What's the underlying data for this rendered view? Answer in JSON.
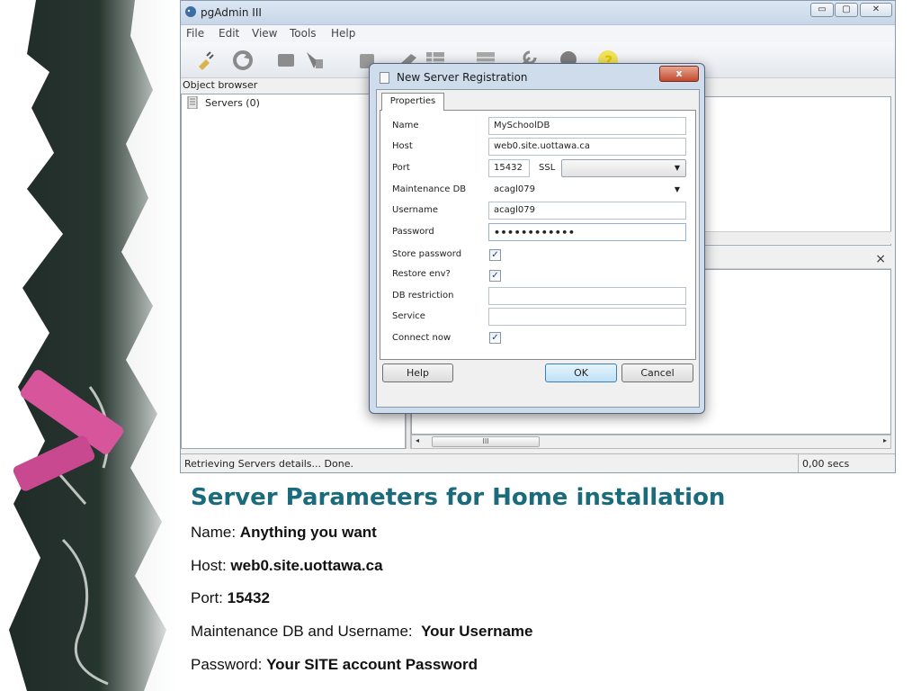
{
  "app": {
    "title": "pgAdmin III",
    "caption_buttons": {
      "minimize": "▭",
      "maximize": "▢",
      "close": "✕"
    },
    "menu": [
      "File",
      "Edit",
      "View",
      "Tools",
      "Help"
    ],
    "toolbar_icons": [
      "plug-icon",
      "refresh-icon",
      "properties-icon",
      "create-object-icon",
      "delete-icon",
      "sql-icon",
      "view-data-icon",
      "filter-icon",
      "maintenance-icon",
      "plugin-icon",
      "help-icon"
    ]
  },
  "object_browser": {
    "header": "Object browser",
    "tree": [
      {
        "label": "Servers (0)",
        "icon": "servers-icon"
      }
    ]
  },
  "sql_pane": {
    "close_glyph": "×"
  },
  "scrollbar": {
    "left_arrow": "◂",
    "right_arrow": "▸",
    "thumb_grip": "III"
  },
  "statusbar": {
    "message": "Retrieving Servers details... Done.",
    "timer": "0,00 secs"
  },
  "dialog": {
    "title": "New Server Registration",
    "close_glyph": "x",
    "tab": "Properties",
    "fields": {
      "name": {
        "label": "Name",
        "value": "MySchoolDB"
      },
      "host": {
        "label": "Host",
        "value": "web0.site.uottawa.ca"
      },
      "port": {
        "label": "Port",
        "value": "15432"
      },
      "ssl": {
        "label": "SSL",
        "value": ""
      },
      "maintenance_db": {
        "label": "Maintenance DB",
        "value": "acagl079"
      },
      "username": {
        "label": "Username",
        "value": "acagl079"
      },
      "password": {
        "label": "Password",
        "value": "••••••••••••"
      },
      "store_password": {
        "label": "Store password",
        "checked": true
      },
      "restore_env": {
        "label": "Restore env?",
        "checked": true
      },
      "db_restriction": {
        "label": "DB restriction",
        "value": ""
      },
      "service": {
        "label": "Service",
        "value": ""
      },
      "connect_now": {
        "label": "Connect now",
        "checked": true
      }
    },
    "check_glyph": "✓",
    "dropdown_glyph": "▼",
    "buttons": {
      "help": "Help",
      "ok": "OK",
      "cancel": "Cancel"
    }
  },
  "slide": {
    "title": "Server Parameters for Home installation",
    "lines": [
      {
        "label": "Name: ",
        "value": "Anything you want"
      },
      {
        "label": "Host: ",
        "value": "web0.site.uottawa.ca"
      },
      {
        "label": "Port: ",
        "value": "15432"
      },
      {
        "label": "Maintenance DB and Username:  ",
        "value": "Your Username"
      },
      {
        "label": "Password: ",
        "value": "Your SITE account Password"
      }
    ]
  },
  "colors": {
    "slide_title": "#1a6b7c",
    "chalk_pink": "#d6559b",
    "dialog_frame": "#cfdcec"
  }
}
